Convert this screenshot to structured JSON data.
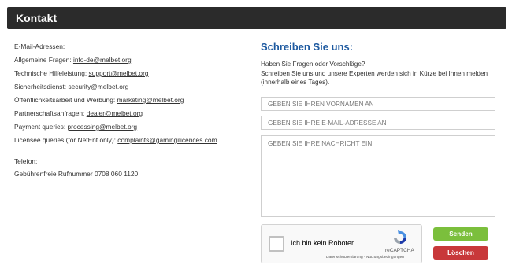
{
  "header": {
    "title": "Kontakt"
  },
  "contact": {
    "emails_heading": "E-Mail-Adressen:",
    "items": [
      {
        "label": "Allgemeine Fragen:",
        "email": "info-de@melbet.org"
      },
      {
        "label": "Technische Hilfeleistung:",
        "email": "support@melbet.org"
      },
      {
        "label": "Sicherheitsdienst:",
        "email": "security@melbet.org"
      },
      {
        "label": "Öffentlichkeitsarbeit und Werbung:",
        "email": "marketing@melbet.org"
      },
      {
        "label": "Partnerschaftsanfragen:",
        "email": "dealer@melbet.org"
      },
      {
        "label": "Payment queries:",
        "email": "processing@melbet.org"
      },
      {
        "label": "Licensee queries (for NetEnt only):",
        "email": "complaints@gamingilicences.com"
      }
    ],
    "phone_heading": "Telefon:",
    "phone_line": "Gebührenfreie Rufnummer 0708 060 1120"
  },
  "form": {
    "title": "Schreiben Sie uns:",
    "intro_line1": "Haben Sie Fragen oder Vorschläge?",
    "intro_line2": "Schreiben Sie uns und unsere Experten werden sich in Kürze bei Ihnen melden (innerhalb eines Tages).",
    "name_placeholder": "GEBEN SIE IHREN VORNAMEN AN",
    "email_placeholder": "GEBEN SIE IHRE E-MAIL-ADRESSE AN",
    "message_placeholder": "GEBEN SIE IHRE NACHRICHT EIN",
    "send_label": "Senden",
    "clear_label": "Löschen"
  },
  "captcha": {
    "label": "Ich bin kein Roboter.",
    "brand": "reCAPTCHA",
    "links": "Datenschutzerklärung - Nutzungsbedingungen"
  },
  "colors": {
    "header_bg": "#2b2b2b",
    "title_blue": "#1e5aa0",
    "send_green": "#7bbf3c",
    "clear_red": "#c8383a"
  },
  "icons": [
    "recaptcha-logo-icon",
    "checkbox-icon"
  ]
}
